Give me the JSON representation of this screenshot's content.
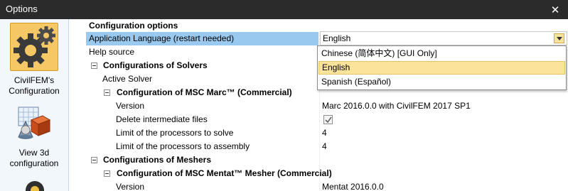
{
  "window": {
    "title": "Options",
    "close_glyph": "✕"
  },
  "sidebar": {
    "items": [
      {
        "label_line1": "CivilFEM's",
        "label_line2": "Configuration",
        "icon": "gears-icon",
        "selected": true
      },
      {
        "label_line1": "View 3d",
        "label_line2": "configuration",
        "icon": "view-3d-icon",
        "selected": false
      }
    ]
  },
  "grid": {
    "config_options_header": "Configuration options",
    "app_language_label": "Application Language (restart needed)",
    "app_language_value": "English",
    "help_source_label": "Help source",
    "solvers_header": "Configurations of Solvers",
    "active_solver_label": "Active Solver",
    "marc_header": "Configuration of MSC Marc™ (Commercial)",
    "marc_version_label": "Version",
    "marc_version_value": "Marc 2016.0.0 with CivilFEM 2017 SP1",
    "delete_files_label": "Delete intermediate files",
    "delete_files_checked": true,
    "proc_solve_label": "Limit of the processors to solve",
    "proc_solve_value": "4",
    "proc_assembly_label": "Limit of the processors to assembly",
    "proc_assembly_value": "4",
    "meshers_header": "Configurations of Meshers",
    "mentat_header": "Configuration of MSC Mentat™ Mesher (Commercial)",
    "mentat_version_label": "Version",
    "mentat_version_value": "Mentat 2016.0.0"
  },
  "language_dropdown": {
    "options": [
      "Chinese (简体中文) [GUI Only]",
      "English",
      "Spanish (Español)"
    ],
    "highlighted": "English"
  },
  "colors": {
    "titlebar": "#2b2b2b",
    "selection": "#99c9ef",
    "highlight": "#fbe39b",
    "sidebar_selected": "#f6c765"
  }
}
